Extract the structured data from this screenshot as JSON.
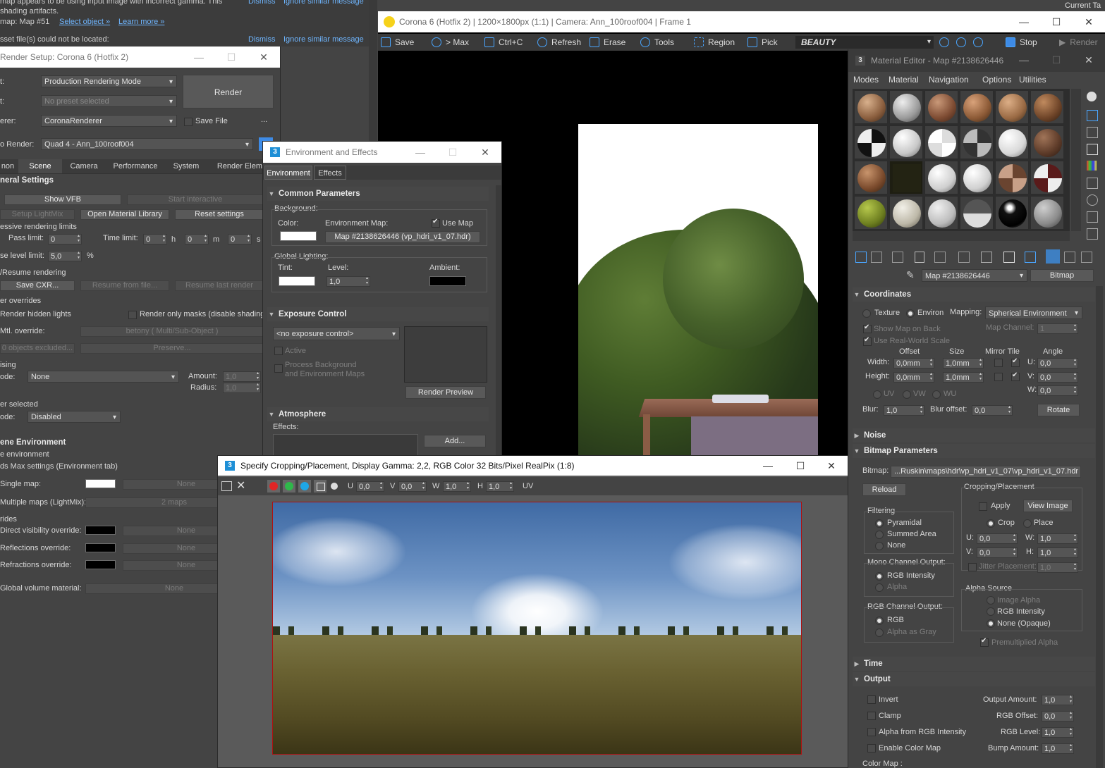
{
  "top_notice": {
    "line1": "map appears to be using input image with incorrect gamma. This",
    "line1b": "shading artifacts.",
    "line2_prefix": "map: Map #51",
    "line2_link1": "Select object »",
    "line2_link2": "Learn more »",
    "line3": "sset file(s) could not be located:",
    "dismiss": "Dismiss",
    "ignore": "Ignore similar message",
    "current_tab": "Current Ta"
  },
  "render_setup": {
    "title": "Render Setup: Corona 6 (Hotfix 2)",
    "row_target_label": "t:",
    "target_value": "Production Rendering Mode",
    "row_preset_label": "t:",
    "preset_value": "No preset selected",
    "row_renderer_label": "erer:",
    "renderer_value": "CoronaRenderer",
    "save_file_label": "Save File",
    "ellipsis": "...",
    "render_button": "Render",
    "view_to_render_label": "o Render:",
    "view_to_render_value": "Quad 4 - Ann_100roof004",
    "tabs": [
      "non",
      "Scene",
      "Camera",
      "Performance",
      "System",
      "Render Eleme"
    ],
    "general_settings": "neral Settings",
    "show_vfb": "Show VFB",
    "start_interactive": "Start interactive",
    "setup_lightmix": "Setup LightMix",
    "open_material_library": "Open Material Library",
    "reset_settings": "Reset settings",
    "progressive_limits": "essive rendering limits",
    "pass_limit_label": "Pass limit:",
    "pass_limit_value": "0",
    "time_limit_label": "Time limit:",
    "time_h_value": "0",
    "time_h_unit": "h",
    "time_m_value": "0",
    "time_m_unit": "m",
    "time_s_value": "0",
    "time_s_unit": "s",
    "noise_limit_label": "se level limit:",
    "noise_limit_value": "5,0",
    "noise_unit": "%",
    "resume_label": "/Resume rendering",
    "save_cxr": "Save CXR...",
    "resume_from_file": "Resume from file...",
    "resume_last": "Resume last render",
    "overrides_label": "er overrides",
    "render_hidden_lights": "Render hidden lights",
    "render_only_masks": "Render only masks (disable shading)",
    "mtl_override_label": "Mtl. override:",
    "mtl_override_value": "betony  ( Multi/Sub-Object )",
    "objects_excluded": "0 objects excluded...",
    "preserve": "Preserve...",
    "denoising_label": "ising",
    "denoise_mode_label": "ode:",
    "denoise_mode_value": "None",
    "amount_label": "Amount:",
    "amount_value": "1,0",
    "radius_label": "Radius:",
    "radius_value": "1,0",
    "render_selected_label": "er selected",
    "render_selected_mode_label": "ode:",
    "render_selected_mode_value": "Disabled",
    "scene_env_label": "ene Environment",
    "env_sub": "e environment",
    "max_settings": "ds Max settings (Environment tab)",
    "single_map_label": "Single map:",
    "single_map_value": "None",
    "multiple_maps_label": "Multiple maps (LightMix):",
    "multiple_maps_value": "2 maps",
    "rides_label": "rides",
    "direct_vis_label": "Direct visibility override:",
    "direct_vis_value": "None",
    "reflections_label": "Reflections override:",
    "reflections_value": "None",
    "refractions_label": "Refractions override:",
    "refractions_value": "None",
    "global_volume_label": "Global volume material:",
    "global_volume_value": "None"
  },
  "vfb": {
    "title": "Corona 6 (Hotfix 2) | 1200×1800px (1:1) | Camera: Ann_100roof004 | Frame 1",
    "toolbar": [
      "Save",
      "> Max",
      "Ctrl+C",
      "Refresh",
      "Erase",
      "Tools",
      "Region",
      "Pick"
    ],
    "channel": "BEAUTY",
    "stop": "Stop",
    "render": "Render"
  },
  "env_effects": {
    "title": "Environment and Effects",
    "tab_environment": "Environment",
    "tab_effects": "Effects",
    "common_params": "Common Parameters",
    "background_label": "Background:",
    "color_label": "Color:",
    "env_map_label": "Environment Map:",
    "use_map_label": "Use Map",
    "env_map_value": "Map #2138626446 (vp_hdri_v1_07.hdr)",
    "global_lighting_label": "Global Lighting:",
    "tint_label": "Tint:",
    "level_label": "Level:",
    "level_value": "1,0",
    "ambient_label": "Ambient:",
    "exposure_control": "Exposure Control",
    "exposure_value": "<no exposure control>",
    "active_label": "Active",
    "process_bg_label": "Process Background",
    "process_bg_label2": "and Environment Maps",
    "render_preview": "Render Preview",
    "atmosphere": "Atmosphere",
    "effects_label": "Effects:",
    "add_button": "Add..."
  },
  "crop_window": {
    "title": "Specify Cropping/Placement, Display Gamma: 2,2, RGB Color 32 Bits/Pixel RealPix (1:8)",
    "u_label": "U",
    "u_value": "0,0",
    "v_label": "V",
    "v_value": "0,0",
    "w_label": "W",
    "w_value": "1,0",
    "h_label": "H",
    "h_value": "1,0",
    "uv_label": "UV"
  },
  "material_editor": {
    "title": "Material Editor - Map #2138626446",
    "menu": [
      "Modes",
      "Material",
      "Navigation",
      "Options",
      "Utilities"
    ],
    "map_name": "Map #2138626446",
    "map_type": "Bitmap",
    "coordinates": "Coordinates",
    "texture_label": "Texture",
    "environ_label": "Environ",
    "mapping_label": "Mapping:",
    "mapping_value": "Spherical Environment",
    "show_map_on_back": "Show Map on Back",
    "map_channel_label": "Map Channel:",
    "map_channel_value": "1",
    "real_world_scale": "Use Real-World Scale",
    "offset_hdr": "Offset",
    "size_hdr": "Size",
    "mirror_tile_hdr": "Mirror Tile",
    "angle_hdr": "Angle",
    "width_label": "Width:",
    "width_offset": "0,0mm",
    "width_size": "1,0mm",
    "height_label": "Height:",
    "height_offset": "0,0mm",
    "height_size": "1,0mm",
    "u_angle_label": "U:",
    "u_angle": "0,0",
    "v_angle_label": "V:",
    "v_angle": "0,0",
    "w_angle_label": "W:",
    "w_angle": "0,0",
    "uv_label": "UV",
    "vw_label": "VW",
    "wu_label": "WU",
    "blur_label": "Blur:",
    "blur_value": "1,0",
    "blur_offset_label": "Blur offset:",
    "blur_offset_value": "0,0",
    "rotate": "Rotate",
    "noise": "Noise",
    "bitmap_params": "Bitmap Parameters",
    "bitmap_label": "Bitmap:",
    "bitmap_path": "...Ruskin\\maps\\hdr\\vp_hdri_v1_07\\vp_hdri_v1_07.hdr",
    "reload": "Reload",
    "cropping_placement": "Cropping/Placement",
    "apply_label": "Apply",
    "view_image": "View Image",
    "crop_label": "Crop",
    "place_label": "Place",
    "cu_label": "U:",
    "cu_value": "0,0",
    "cw_label": "W:",
    "cw_value": "1,0",
    "cv_label": "V:",
    "cv_value": "0,0",
    "ch_label": "H:",
    "ch_value": "1,0",
    "jitter_label": "Jitter Placement:",
    "jitter_value": "1,0",
    "filtering": "Filtering",
    "pyramidal": "Pyramidal",
    "summed_area": "Summed Area",
    "none_filter": "None",
    "mono_output": "Mono Channel Output:",
    "rgb_intensity": "RGB Intensity",
    "alpha": "Alpha",
    "alpha_source": "Alpha Source",
    "image_alpha": "Image Alpha",
    "rgb_intensity2": "RGB Intensity",
    "none_opaque": "None (Opaque)",
    "rgb_output": "RGB Channel Output:",
    "rgb": "RGB",
    "alpha_as_gray": "Alpha as Gray",
    "premultiplied": "Premultiplied Alpha",
    "time": "Time",
    "output": "Output",
    "invert": "Invert",
    "output_amount_label": "Output Amount:",
    "output_amount": "1,0",
    "clamp": "Clamp",
    "rgb_offset_label": "RGB Offset:",
    "rgb_offset": "0,0",
    "alpha_from_rgb": "Alpha from RGB Intensity",
    "rgb_level_label": "RGB Level:",
    "rgb_level": "1,0",
    "enable_color_map": "Enable Color Map",
    "bump_amount_label": "Bump Amount:",
    "bump_amount": "1,0",
    "color_map": "Color Map :"
  },
  "colors": {
    "panel_bg": "#444444",
    "accent_blue": "#3e9bff",
    "vfb_bg": "#000000"
  }
}
